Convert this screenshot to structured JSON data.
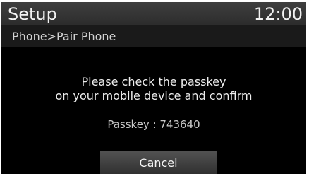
{
  "header": {
    "title": "Setup",
    "time": "12:00"
  },
  "breadcrumb": {
    "path": "Phone>Pair Phone"
  },
  "dialog": {
    "message_line1": "Please check the passkey",
    "message_line2": "on your mobile device and confirm",
    "passkey": "Passkey : 743640",
    "cancel_label": "Cancel"
  }
}
